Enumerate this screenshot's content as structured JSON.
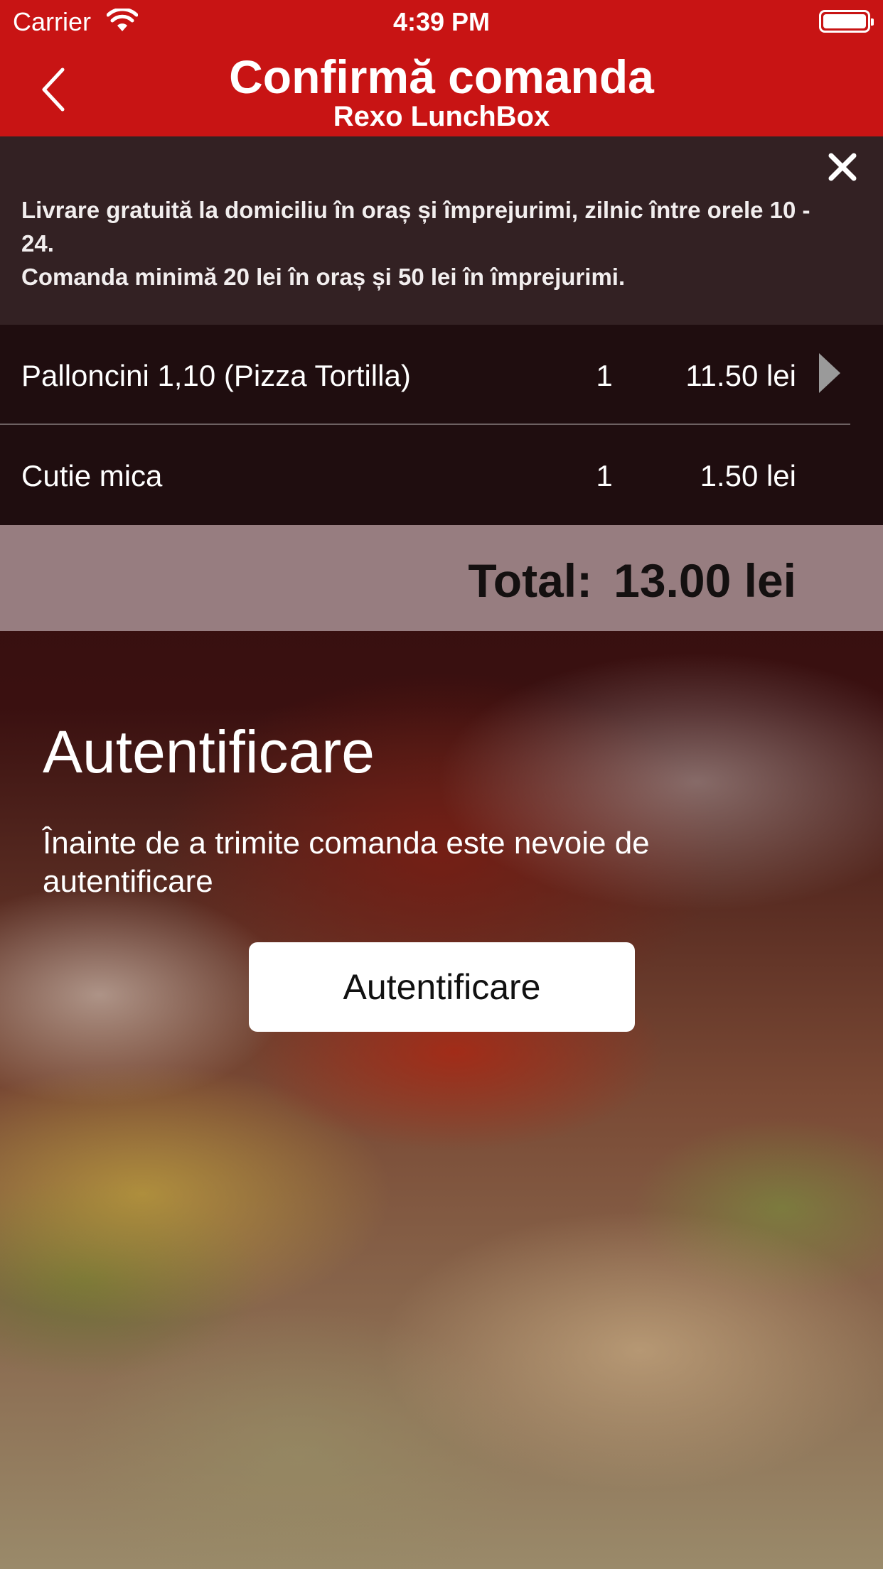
{
  "status_bar": {
    "carrier": "Carrier",
    "time": "4:39 PM"
  },
  "nav": {
    "title": "Confirmă comanda",
    "subtitle": "Rexo LunchBox"
  },
  "info_banner": {
    "line1": "Livrare gratuită la domiciliu în oraș și împrejurimi, zilnic între orele 10 - 24.",
    "line2": "Comanda minimă 20 lei în oraș și 50 lei în împrejurimi."
  },
  "order": {
    "items": [
      {
        "name": "Palloncini  1,10",
        "variant": "(Pizza Tortilla)",
        "qty": "1",
        "price": "11.50 lei"
      },
      {
        "name": "Cutie mica",
        "variant": "",
        "qty": "1",
        "price": "1.50 lei"
      }
    ],
    "total_label": "Total:",
    "total_value": "13.00 lei"
  },
  "auth": {
    "title": "Autentificare",
    "description": "Înainte de a trimite comanda este nevoie de autentificare",
    "button_label": "Autentificare"
  },
  "colors": {
    "brand_red": "#c81414",
    "banner_bg": "#342224",
    "list_bg": "#1e0e10",
    "total_bg": "#a0878a"
  },
  "icons": {
    "back": "chevron-left-icon",
    "close": "close-icon",
    "row_arrow": "triangle-right-icon",
    "wifi": "wifi-icon",
    "battery": "battery-icon"
  }
}
